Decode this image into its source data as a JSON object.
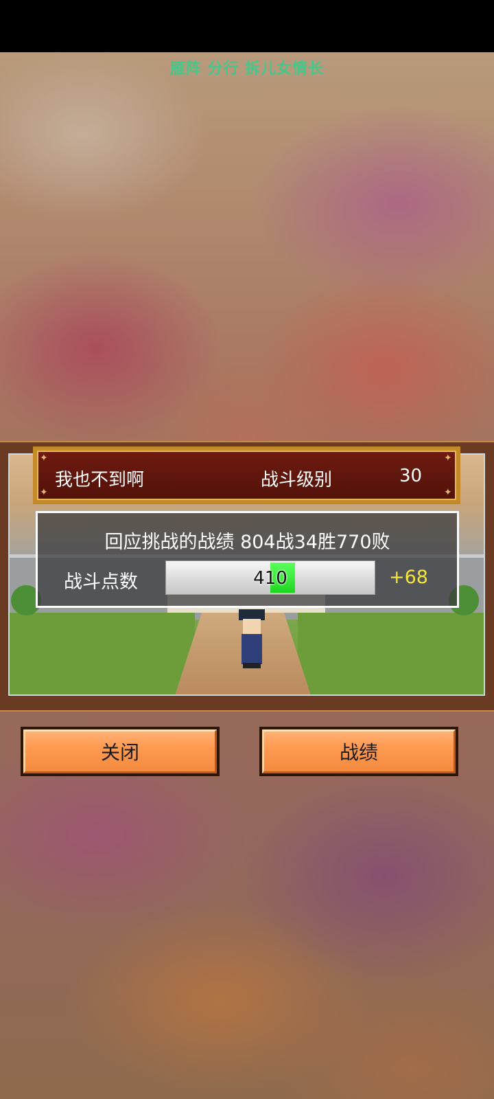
{
  "top_title": "雁阵 分行 拆儿女情长",
  "header": {
    "player_name": "我也不到啊",
    "battle_level_label": "战斗级别",
    "battle_level_value": "30"
  },
  "record": {
    "summary": "回应挑战的战绩 804战34胜770败",
    "points_label": "战斗点数",
    "points_value": "410",
    "points_progress_fraction": 0.12,
    "points_delta": "+68"
  },
  "buttons": {
    "close_label": "关闭",
    "record_label": "战绩"
  },
  "colors": {
    "title_green": "#47c88a",
    "header_bg": "#5e160b",
    "button_orange": "#ff9a52",
    "delta_yellow": "#f4e63a",
    "bar_green": "#2ee02e"
  }
}
